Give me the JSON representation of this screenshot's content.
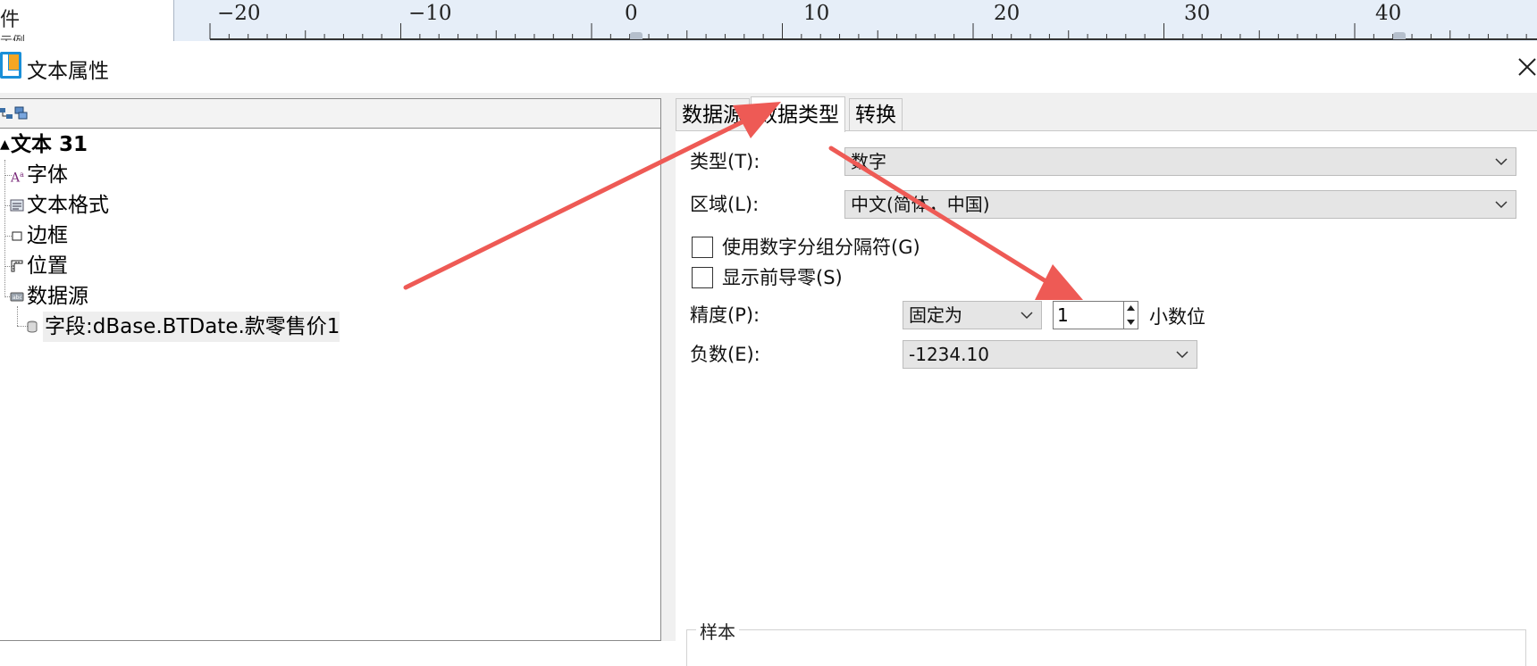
{
  "background_app": {
    "left_text_top": "件",
    "left_text_bottom": "示例",
    "ruler_numbers": [
      "−20",
      "−10",
      "0",
      "10",
      "20",
      "30",
      "40"
    ]
  },
  "dialog": {
    "title": "文本属性",
    "close_icon": "close-icon"
  },
  "left_panel": {
    "toolbar_icons": [
      "tree-expand-icon",
      "tree-collapse-icon"
    ],
    "tree": {
      "root": "文本 31",
      "items": [
        {
          "label": "字体",
          "icon": "font-icon"
        },
        {
          "label": "文本格式",
          "icon": "text-format-icon"
        },
        {
          "label": "边框",
          "icon": "border-icon"
        },
        {
          "label": "位置",
          "icon": "position-icon"
        },
        {
          "label": "数据源",
          "icon": "datasource-icon"
        }
      ],
      "datasource_child": {
        "label": "字段:dBase.BTDate.款零售价1",
        "icon": "database-icon"
      }
    }
  },
  "right_panel": {
    "tabs": [
      {
        "label": "数据源",
        "active": false
      },
      {
        "label": "数据类型",
        "active": true
      },
      {
        "label": "转换",
        "active": false
      }
    ],
    "type": {
      "label": "类型(T):",
      "value": "数字"
    },
    "region": {
      "label": "区域(L):",
      "value": "中文(简体，中国)"
    },
    "use_group_separator": {
      "label": "使用数字分组分隔符(G)",
      "checked": false
    },
    "show_leading_zero": {
      "label": "显示前导零(S)",
      "checked": false
    },
    "precision": {
      "label": "精度(P):",
      "mode": "固定为",
      "value": "1",
      "unit": "小数位"
    },
    "negative": {
      "label": "负数(E):",
      "value": "-1234.10"
    },
    "sample": {
      "legend": "样本"
    }
  },
  "annotation_color": "#ee5a55"
}
